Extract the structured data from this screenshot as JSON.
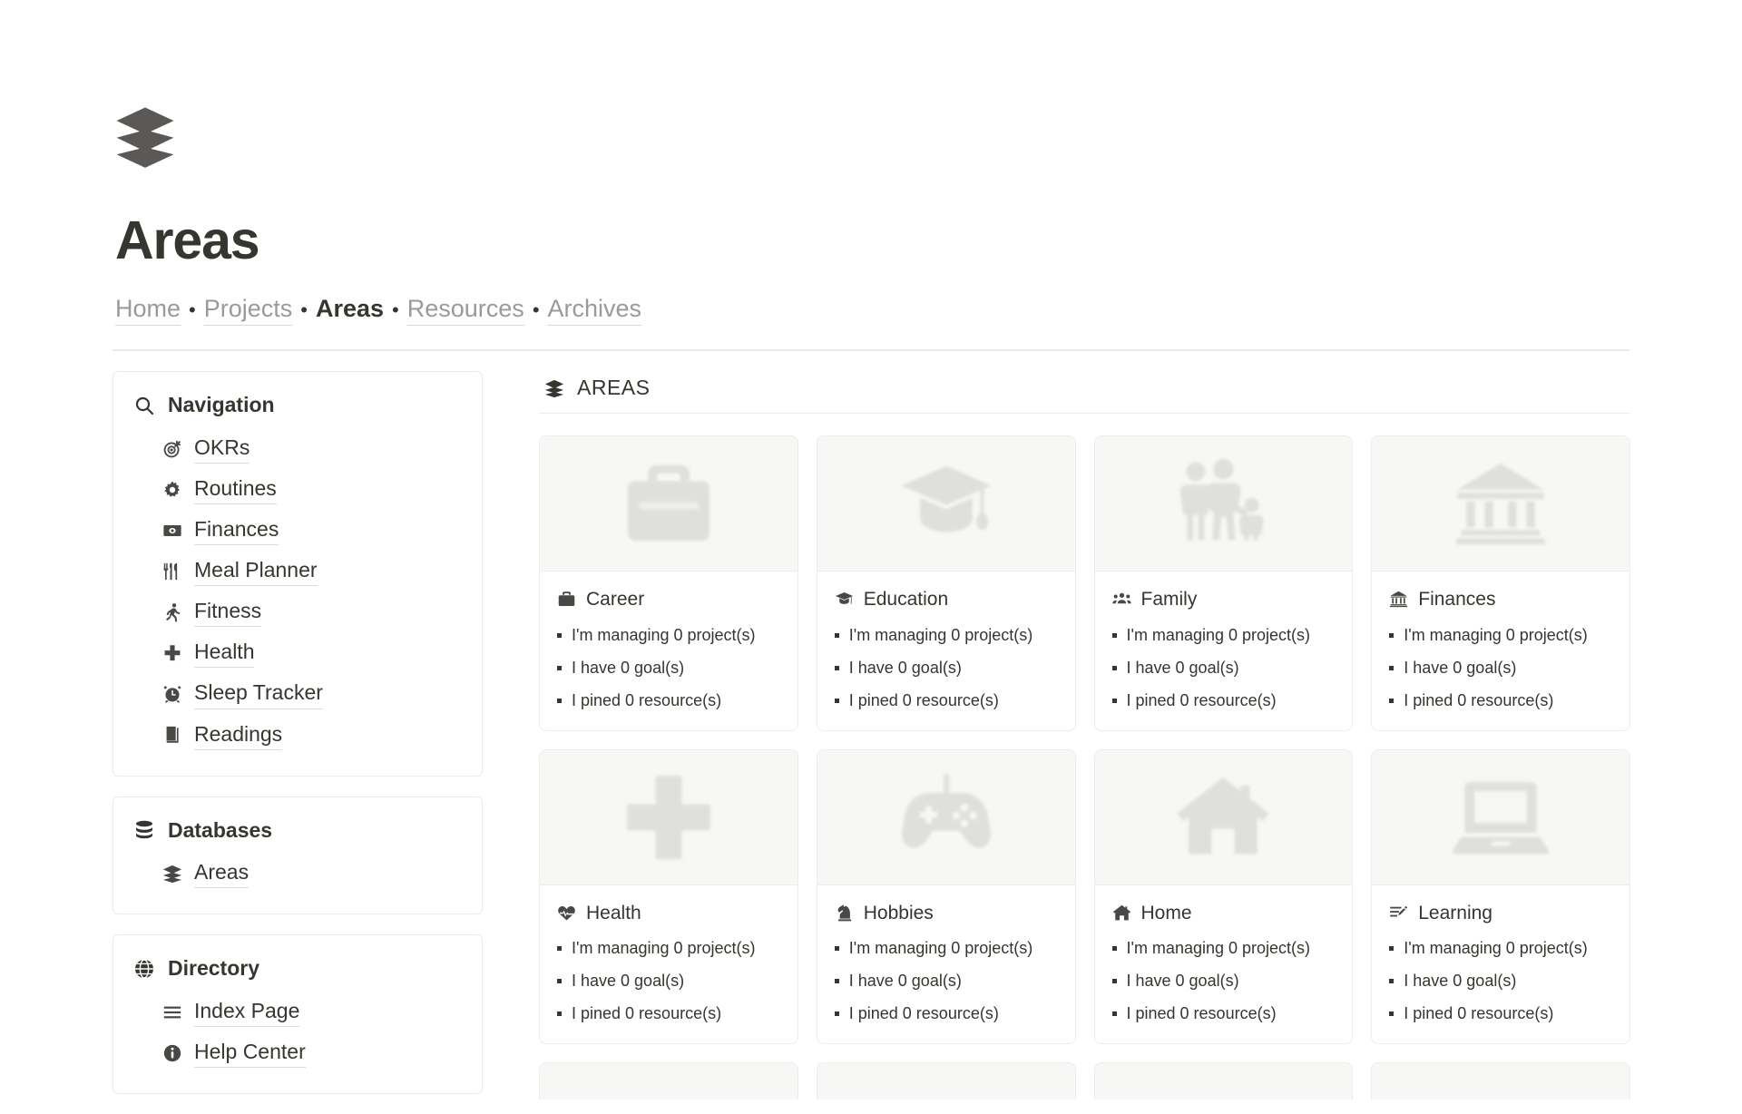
{
  "page": {
    "icon": "layers-icon",
    "title": "Areas"
  },
  "breadcrumb": {
    "separator": "•",
    "items": [
      {
        "label": "Home",
        "current": false
      },
      {
        "label": "Projects",
        "current": false
      },
      {
        "label": "Areas",
        "current": true
      },
      {
        "label": "Resources",
        "current": false
      },
      {
        "label": "Archives",
        "current": false
      }
    ]
  },
  "sidebar": {
    "panels": [
      {
        "title": "Navigation",
        "icon": "search-icon",
        "items": [
          {
            "label": "OKRs",
            "icon": "target-icon"
          },
          {
            "label": "Routines",
            "icon": "gear-icon"
          },
          {
            "label": "Finances",
            "icon": "banknote-icon"
          },
          {
            "label": "Meal Planner",
            "icon": "utensils-icon"
          },
          {
            "label": "Fitness",
            "icon": "running-icon"
          },
          {
            "label": "Health",
            "icon": "medical-cross-icon"
          },
          {
            "label": "Sleep Tracker",
            "icon": "alarm-clock-icon"
          },
          {
            "label": "Readings",
            "icon": "book-icon"
          }
        ]
      },
      {
        "title": "Databases",
        "icon": "database-icon",
        "items": [
          {
            "label": "Areas",
            "icon": "layers-icon"
          }
        ]
      },
      {
        "title": "Directory",
        "icon": "globe-icon",
        "items": [
          {
            "label": "Index Page",
            "icon": "list-icon"
          },
          {
            "label": "Help Center",
            "icon": "info-circle-icon"
          }
        ]
      }
    ]
  },
  "main": {
    "section_title": "AREAS",
    "section_icon": "layers-icon",
    "cards": [
      {
        "title": "Career",
        "cover_icon": "briefcase-icon",
        "title_icon": "briefcase-icon",
        "bullets": [
          "I'm managing 0 project(s)",
          "I have 0 goal(s)",
          "I pined 0 resource(s)"
        ]
      },
      {
        "title": "Education",
        "cover_icon": "graduation-cap-icon",
        "title_icon": "graduation-cap-icon",
        "bullets": [
          "I'm managing 0 project(s)",
          "I have 0 goal(s)",
          "I pined 0 resource(s)"
        ]
      },
      {
        "title": "Family",
        "cover_icon": "family-icon",
        "title_icon": "people-group-icon",
        "bullets": [
          "I'm managing 0 project(s)",
          "I have 0 goal(s)",
          "I pined 0 resource(s)"
        ]
      },
      {
        "title": "Finances",
        "cover_icon": "bank-icon",
        "title_icon": "bank-icon",
        "bullets": [
          "I'm managing 0 project(s)",
          "I have 0 goal(s)",
          "I pined 0 resource(s)"
        ]
      },
      {
        "title": "Health",
        "cover_icon": "medical-cross-icon",
        "title_icon": "heart-pulse-icon",
        "bullets": [
          "I'm managing 0 project(s)",
          "I have 0 goal(s)",
          "I pined 0 resource(s)"
        ]
      },
      {
        "title": "Hobbies",
        "cover_icon": "gamepad-icon",
        "title_icon": "chess-knight-icon",
        "bullets": [
          "I'm managing 0 project(s)",
          "I have 0 goal(s)",
          "I pined 0 resource(s)"
        ]
      },
      {
        "title": "Home",
        "cover_icon": "house-icon",
        "title_icon": "house-icon",
        "bullets": [
          "I'm managing 0 project(s)",
          "I have 0 goal(s)",
          "I pined 0 resource(s)"
        ]
      },
      {
        "title": "Learning",
        "cover_icon": "laptop-icon",
        "title_icon": "note-edit-icon",
        "bullets": [
          "I'm managing 0 project(s)",
          "I have 0 goal(s)",
          "I pined 0 resource(s)"
        ]
      }
    ]
  },
  "colors": {
    "text": "#37352f",
    "muted": "#9b9a97",
    "border": "#ededeb",
    "cover_bg": "#f7f7f5",
    "cover_icon": "#dededa"
  }
}
